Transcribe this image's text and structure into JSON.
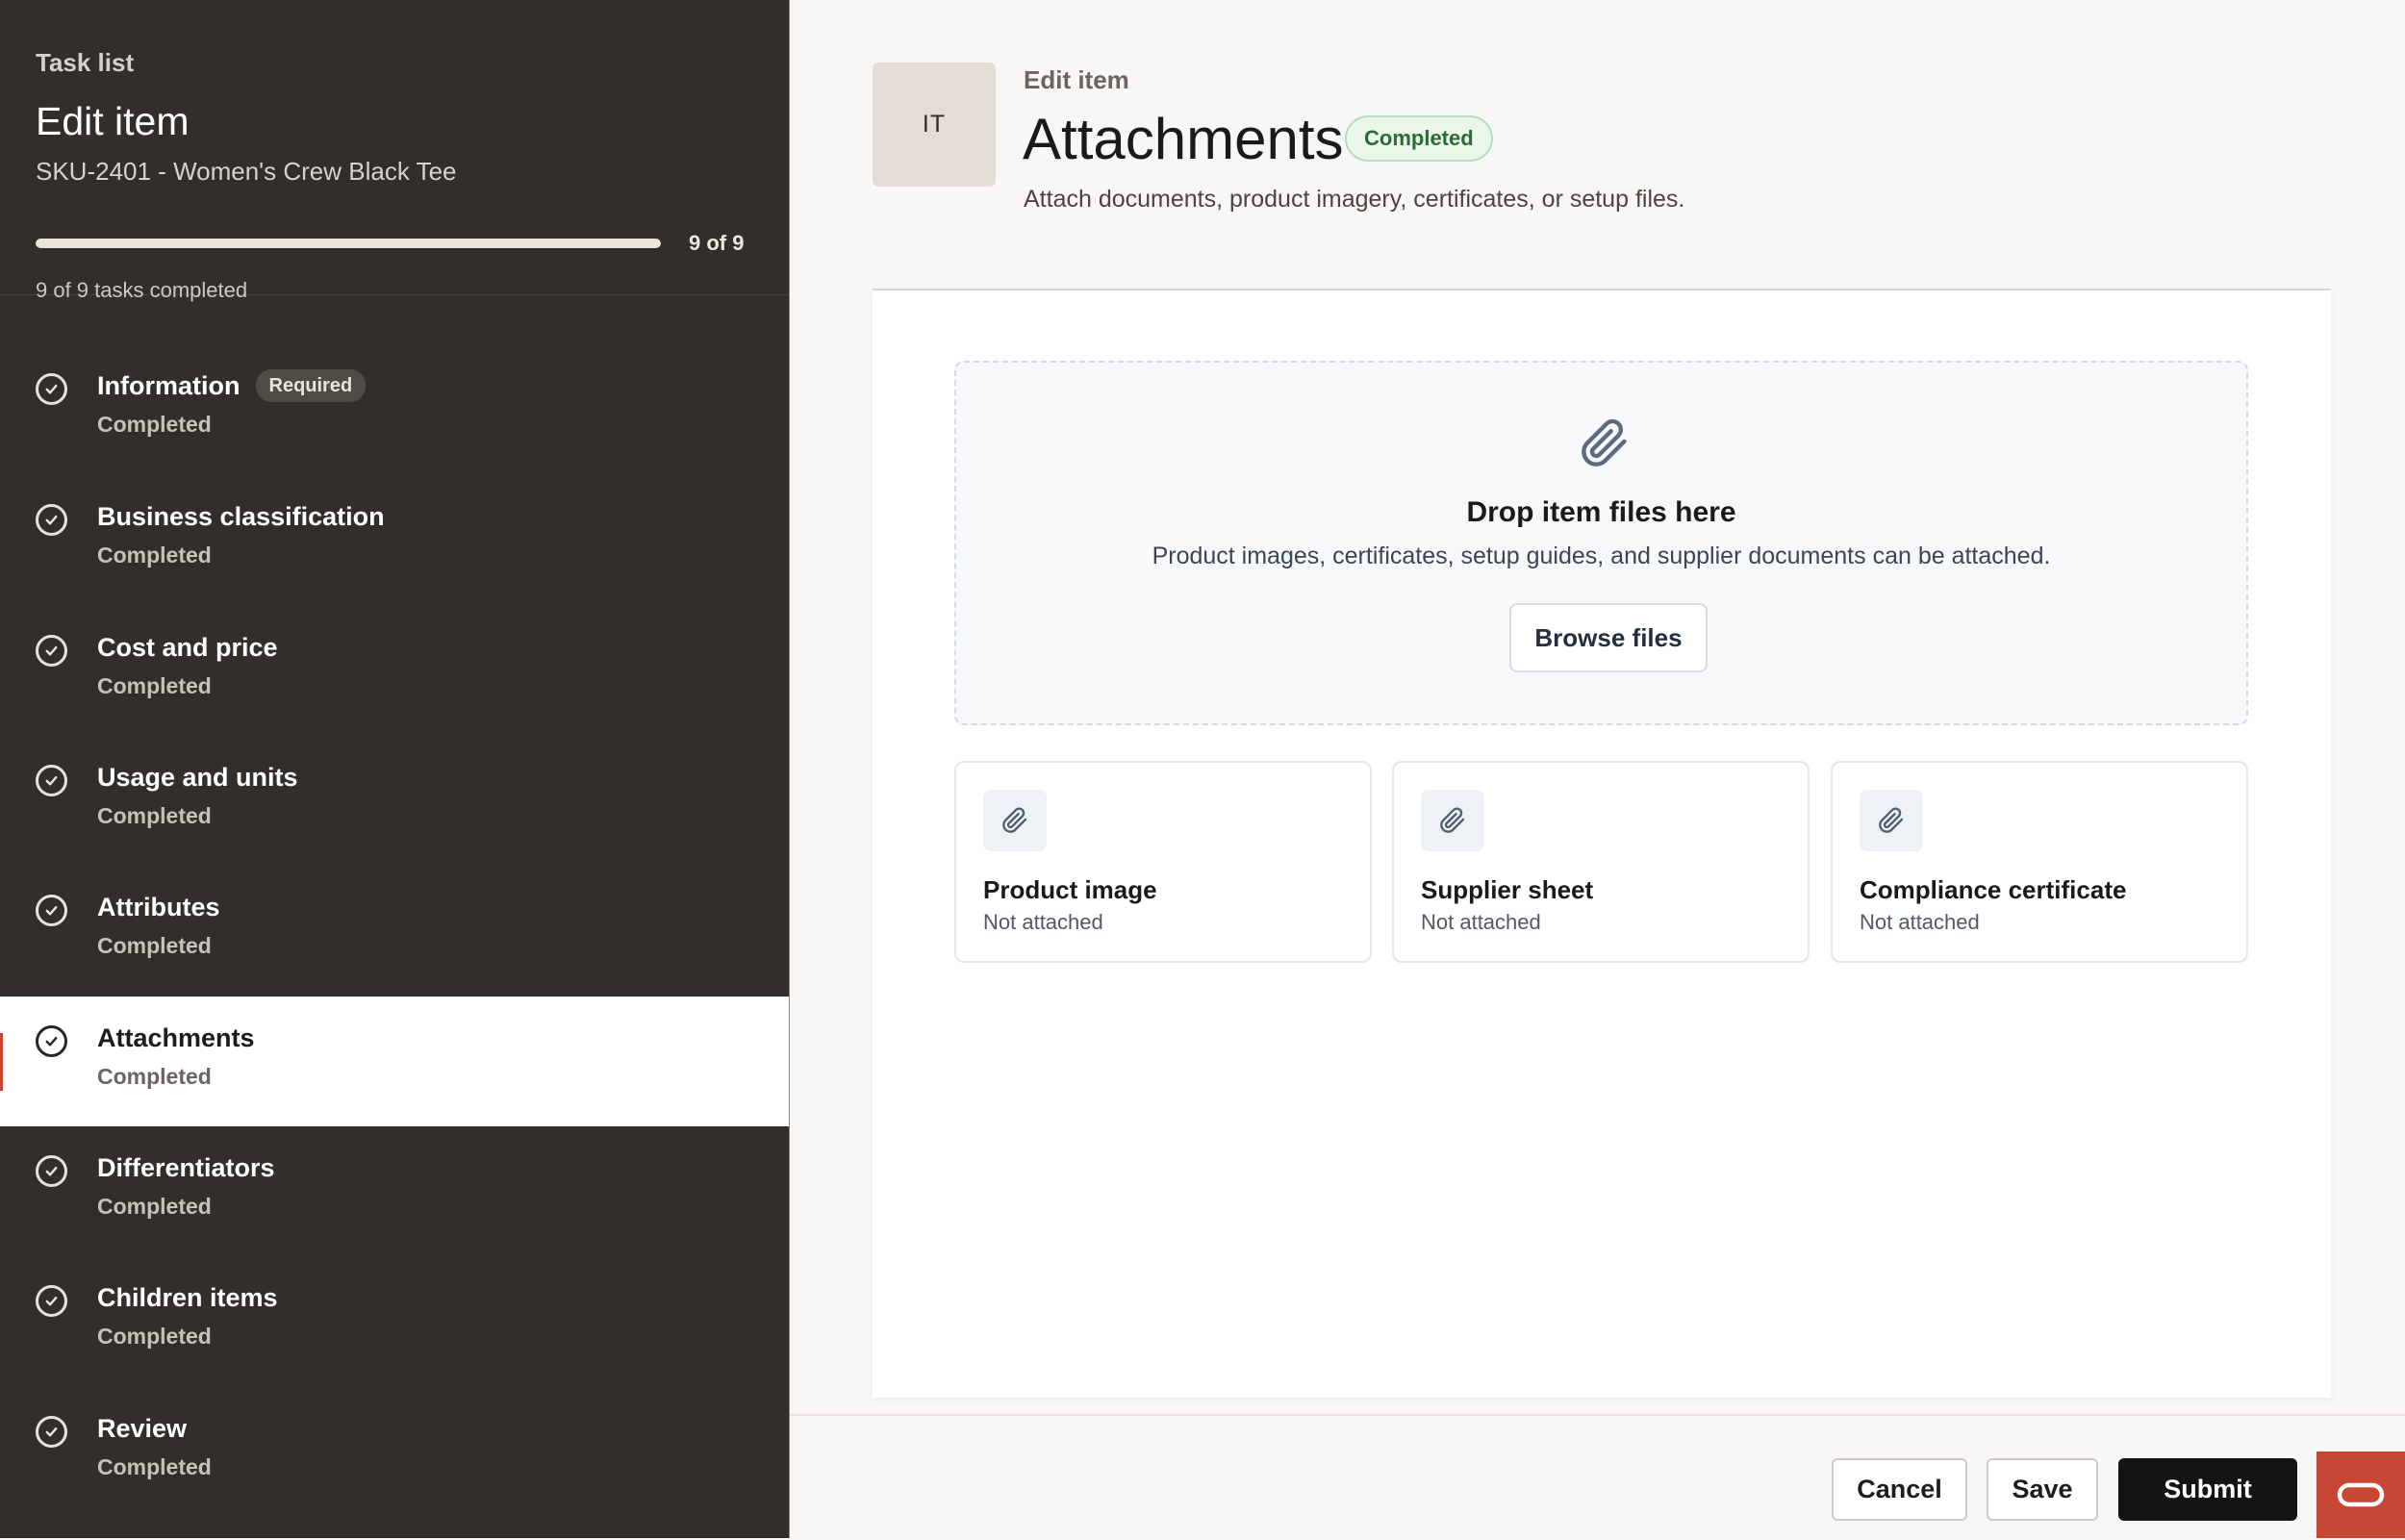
{
  "sidebar": {
    "kicker": "Task list",
    "title": "Edit item",
    "subtitle": "SKU-2401 - Women's Crew Black Tee",
    "progress": {
      "completed": 9,
      "total": 9,
      "fraction": 1.0,
      "count_label": "9 of 9",
      "note": "9 of 9 tasks completed"
    },
    "tasks": [
      {
        "title": "Information",
        "badge": "Required",
        "status": "Completed",
        "icon": "check-circle-icon"
      },
      {
        "title": "Business classification",
        "status": "Completed",
        "icon": "check-circle-icon"
      },
      {
        "title": "Cost and price",
        "status": "Completed",
        "icon": "check-circle-icon"
      },
      {
        "title": "Usage and units",
        "status": "Completed",
        "icon": "check-circle-icon"
      },
      {
        "title": "Attributes",
        "status": "Completed",
        "icon": "check-circle-icon"
      },
      {
        "title": "Attachments",
        "status": "Completed",
        "icon": "check-circle-icon",
        "active": true
      },
      {
        "title": "Differentiators",
        "status": "Completed",
        "icon": "check-circle-icon"
      },
      {
        "title": "Children items",
        "status": "Completed",
        "icon": "check-circle-icon"
      },
      {
        "title": "Review",
        "status": "Completed",
        "icon": "check-circle-icon"
      }
    ]
  },
  "header": {
    "avatar": "IT",
    "kicker": "Edit item",
    "title": "Attachments",
    "status": "Completed",
    "description": "Attach documents, product imagery, certificates, or setup files."
  },
  "dropzone": {
    "icon": "paperclip-icon",
    "title": "Drop item files here",
    "description": "Product images, certificates, setup guides, and supplier documents can be attached.",
    "button": "Browse files"
  },
  "file_slots": [
    {
      "title": "Product image",
      "status": "Not attached",
      "icon": "paperclip-icon"
    },
    {
      "title": "Supplier sheet",
      "status": "Not attached",
      "icon": "paperclip-icon"
    },
    {
      "title": "Compliance certificate",
      "status": "Not attached",
      "icon": "paperclip-icon"
    }
  ],
  "footer": {
    "cancel": "Cancel",
    "save": "Save",
    "submit": "Submit"
  },
  "colors": {
    "sidebar_bg": "#322e2b",
    "accent": "#c74634",
    "success_bg": "#eaf6ea",
    "success_text": "#2d6a36",
    "primary_button": "#151413"
  }
}
